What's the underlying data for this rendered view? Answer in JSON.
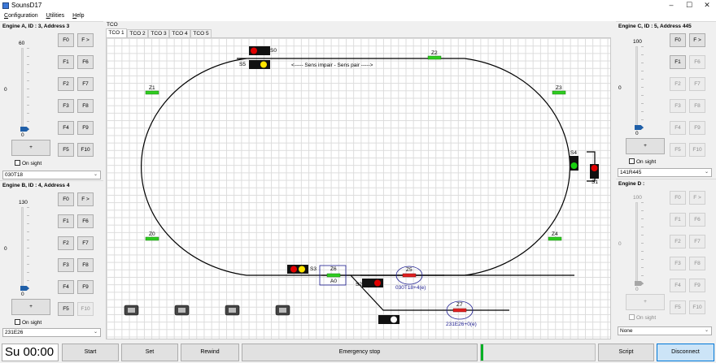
{
  "window": {
    "title": "SounsD17"
  },
  "menu": [
    "Configuration",
    "Utilities",
    "Help"
  ],
  "engines": {
    "a": {
      "title": "Engine A, ID : 3, Address 3",
      "max": "60",
      "value": "0",
      "min": "0",
      "position": 0.0,
      "enabled": true,
      "onsight": "On sight",
      "select": "030T18",
      "set_label": "+",
      "fbuttons": [
        "F0",
        "F >",
        "F1",
        "F6",
        "F2",
        "F7",
        "F3",
        "F8",
        "F4",
        "F9",
        "F5",
        "F10"
      ],
      "disabled_f": []
    },
    "b": {
      "title": "Engine B, ID : 4, Address 4",
      "max": "130",
      "value": "0",
      "min": "0",
      "position": 0.0,
      "enabled": true,
      "onsight": "On sight",
      "select": "231E26",
      "set_label": "+",
      "fbuttons": [
        "F0",
        "F >",
        "F1",
        "F6",
        "F2",
        "F7",
        "F3",
        "F8",
        "F4",
        "F9",
        "F5",
        "F10"
      ],
      "disabled_f": [
        "F10"
      ]
    },
    "c": {
      "title": "Engine C, ID : 5, Address 445",
      "max": "100",
      "value": "0",
      "min": "0",
      "position": 0.0,
      "enabled": true,
      "onsight": "On sight",
      "select": "141R445",
      "set_label": "+",
      "fbuttons": [
        "F0",
        "F >",
        "F1",
        "F6",
        "F2",
        "F7",
        "F3",
        "F8",
        "F4",
        "F9",
        "F5",
        "F10"
      ],
      "disabled_f": [
        "F6",
        "F2",
        "F7",
        "F3",
        "F8",
        "F4",
        "F9",
        "F5",
        "F10"
      ]
    },
    "d": {
      "title": "Engine D :",
      "max": "100",
      "value": "0",
      "min": "0",
      "position": 0.0,
      "enabled": false,
      "onsight": "On sight",
      "select": "None",
      "set_label": "+",
      "fbuttons": [
        "F0",
        "F >",
        "F1",
        "F6",
        "F2",
        "F7",
        "F3",
        "F8",
        "F4",
        "F9",
        "F5",
        "F10"
      ],
      "disabled_f": [
        "F0",
        "F >",
        "F1",
        "F6",
        "F2",
        "F7",
        "F3",
        "F8",
        "F4",
        "F9",
        "F5",
        "F10"
      ]
    }
  },
  "tco": {
    "title": "TCO",
    "tabs": [
      "TCO 1",
      "TCO 2",
      "TCO 3",
      "TCO 4",
      "TCO 5"
    ],
    "direction_text": "<----- Sens impair - Sens pair ----->",
    "signals": {
      "s0": "S0",
      "s1": "S1",
      "s2": "S2",
      "s3": "S3",
      "s4": "S4",
      "s5": "S5"
    },
    "zones": {
      "z0": "Z0",
      "z1": "Z1",
      "z2": "Z2",
      "z3": "Z3",
      "z4": "Z4",
      "z5": "Z5",
      "z6": "Z6",
      "z7": "Z7",
      "a0": "A0"
    },
    "trains": {
      "z5": "030T18+4(e)",
      "z7": "231E26+0(e)"
    },
    "colors": {
      "track": "#000000",
      "zone_free": "#2ecc1f",
      "zone_busy": "#e02020",
      "signal_red": "#e00000",
      "signal_yellow": "#ffe400",
      "signal_green": "#18d010",
      "train_label": "#1b1b8f"
    }
  },
  "bottom": {
    "clock": "Su 00:00",
    "start": "Start",
    "set": "Set",
    "rewind": "Rewind",
    "emergency": "Emergency stop",
    "progress": 0.02,
    "script": "Script",
    "disconnect": "Disconnect"
  }
}
